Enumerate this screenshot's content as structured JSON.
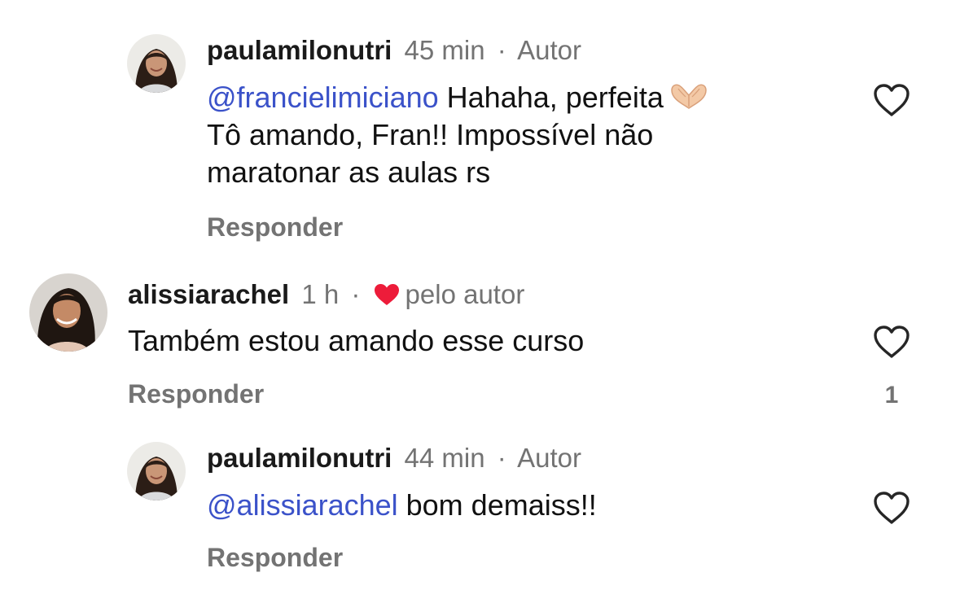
{
  "comments": [
    {
      "username": "paulamilonutri",
      "time": "45 min",
      "separator": "·",
      "role": "Autor",
      "mention": "@francielimiciano",
      "text_line1": " Hahaha, perfeita",
      "text_line2": "Tô amando, Fran!! Impossível não",
      "text_line3": "maratonar as aulas rs",
      "reply_label": "Responder",
      "emoji": "heart-hands-emoji"
    },
    {
      "username": "alissiarachel",
      "time": "1 h",
      "separator": "·",
      "liked_by": "pelo autor",
      "text": "Também estou amando esse curso",
      "reply_label": "Responder",
      "like_count": "1"
    },
    {
      "username": "paulamilonutri",
      "time": "44 min",
      "separator": "·",
      "role": "Autor",
      "mention": "@alissiarachel",
      "text": " bom demaiss!!",
      "reply_label": "Responder"
    }
  ],
  "colors": {
    "mention": "#3b52c9",
    "muted": "#737373",
    "liked_heart": "#ed1c3a",
    "text": "#111111"
  },
  "icons": {
    "like": "heart-outline-icon",
    "liked_by_author": "heart-filled-icon"
  }
}
